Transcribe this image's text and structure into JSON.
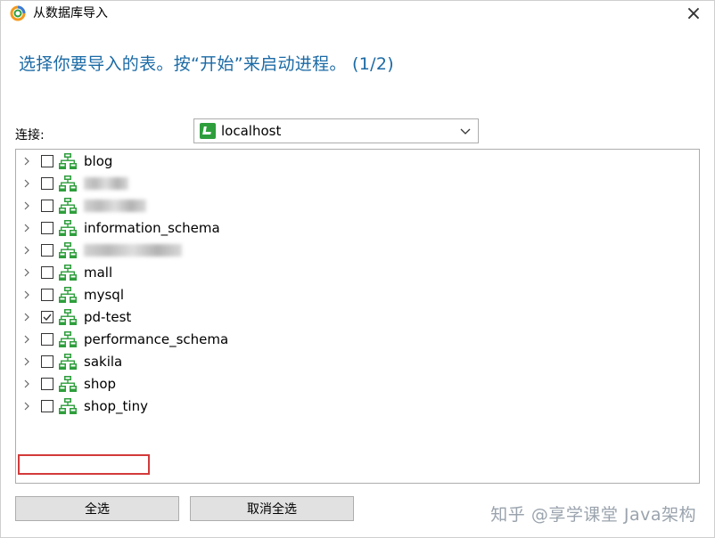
{
  "window": {
    "title": "从数据库导入",
    "close_glyph": "×"
  },
  "instruction": "选择你要导入的表。按“开始”来启动进程。 (1/2)",
  "connection": {
    "label": "连接:",
    "value": "localhost",
    "icon": "connection-icon"
  },
  "databases": [
    {
      "name": "blog",
      "checked": false,
      "blurred": false
    },
    {
      "name": "",
      "checked": false,
      "blurred": true
    },
    {
      "name": "",
      "checked": false,
      "blurred": true
    },
    {
      "name": "information_schema",
      "checked": false,
      "blurred": false
    },
    {
      "name": "",
      "checked": false,
      "blurred": true
    },
    {
      "name": "mall",
      "checked": false,
      "blurred": false
    },
    {
      "name": "mysql",
      "checked": false,
      "blurred": false
    },
    {
      "name": "pd-test",
      "checked": true,
      "blurred": false,
      "highlighted": true
    },
    {
      "name": "performance_schema",
      "checked": false,
      "blurred": false
    },
    {
      "name": "sakila",
      "checked": false,
      "blurred": false
    },
    {
      "name": "shop",
      "checked": false,
      "blurred": false
    },
    {
      "name": "shop_tiny",
      "checked": false,
      "blurred": false
    }
  ],
  "buttons": {
    "select_all": "全选",
    "deselect_all": "取消全选"
  },
  "watermark": "知乎 @享学课堂 Java架构",
  "colors": {
    "instruction": "#1b6aa5",
    "highlight": "#d33a3a",
    "db_icon": "#2e9e3c"
  }
}
